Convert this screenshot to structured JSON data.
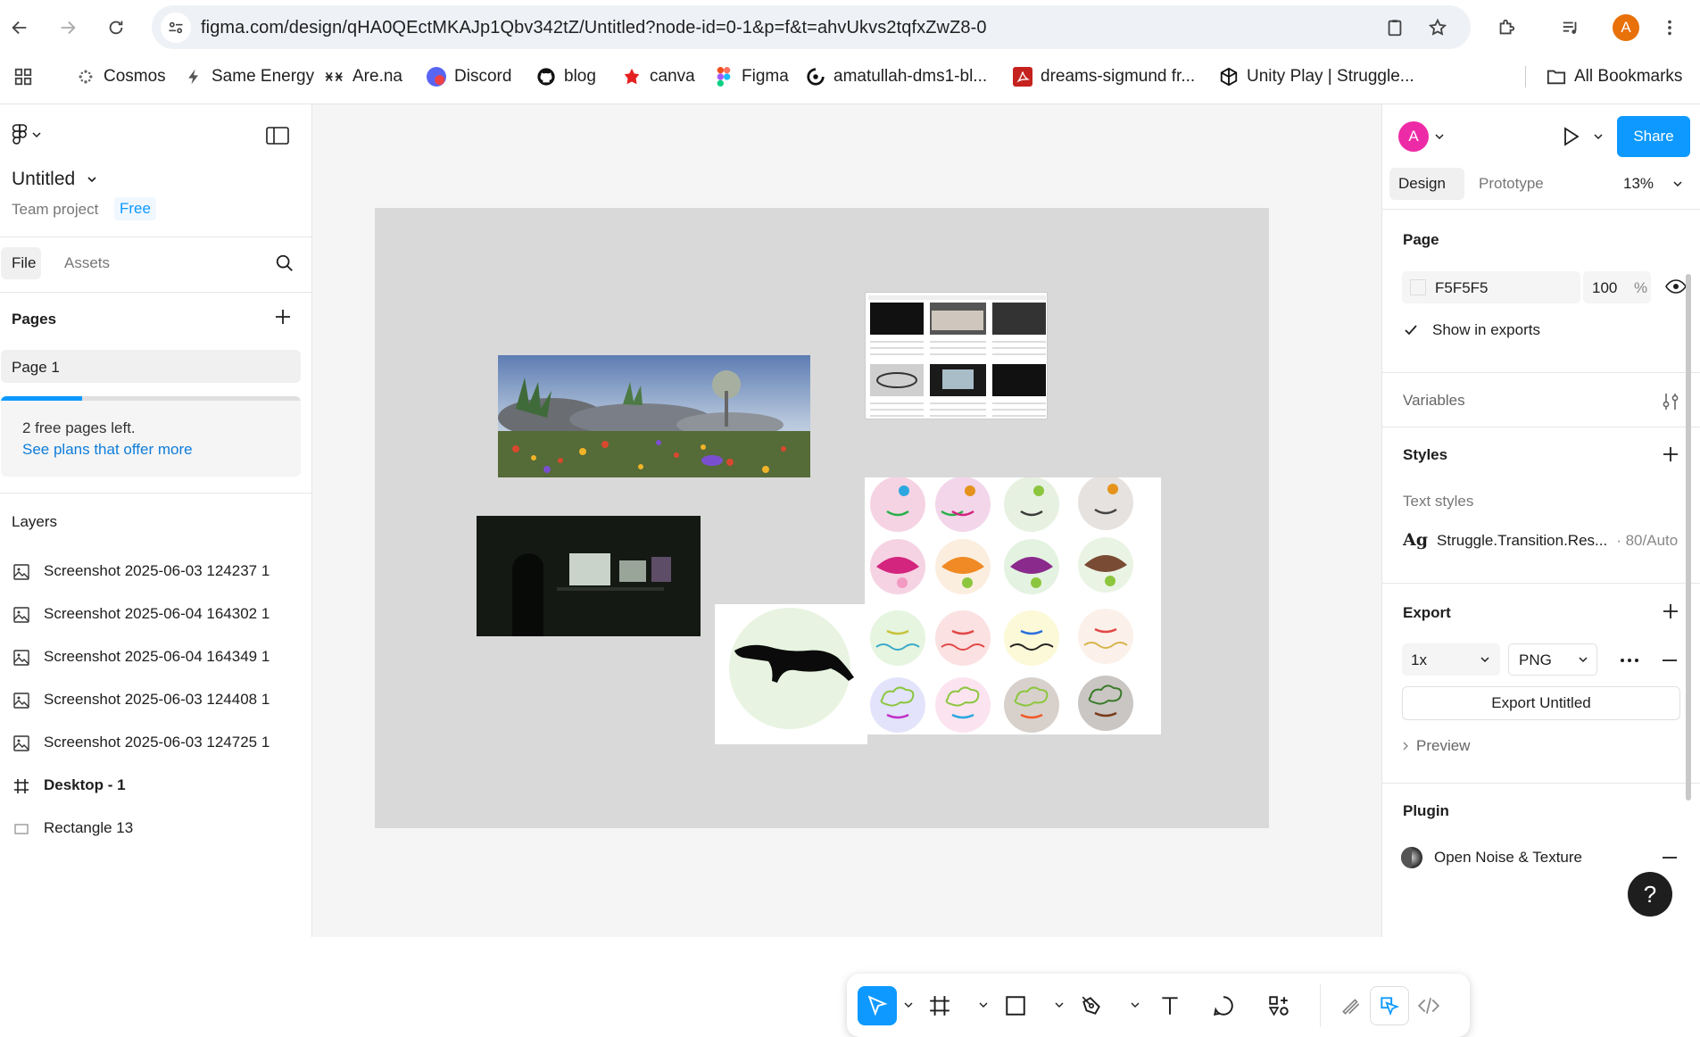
{
  "browser": {
    "url": "figma.com/design/qHA0QEctMKAJp1Qbv342tZ/Untitled?node-id=0-1&p=f&t=ahvUkvs2tqfxZwZ8-0",
    "profile_initial": "A",
    "bookmarks": [
      {
        "label": "Cosmos",
        "icon": "cosmos-icon"
      },
      {
        "label": "Same Energy",
        "icon": "lightning-icon"
      },
      {
        "label": "Are.na",
        "icon": "arena-icon"
      },
      {
        "label": "Discord",
        "icon": "discord-icon"
      },
      {
        "label": "blog",
        "icon": "github-icon"
      },
      {
        "label": "canva",
        "icon": "canva-icon"
      },
      {
        "label": "Figma",
        "icon": "figma-icon"
      },
      {
        "label": "amatullah-dms1-bl...",
        "icon": "github-icon"
      },
      {
        "label": "dreams-sigmund fr...",
        "icon": "pdf-icon"
      },
      {
        "label": "Unity Play | Struggle...",
        "icon": "unity-icon"
      }
    ],
    "all_bookmarks": "All Bookmarks"
  },
  "left_panel": {
    "file_name": "Untitled",
    "project": "Team project",
    "plan_badge": "Free",
    "tabs": {
      "file": "File",
      "assets": "Assets"
    },
    "pages_heading": "Pages",
    "pages": [
      {
        "label": "Page 1"
      }
    ],
    "upsell": {
      "line1": "2 free pages left.",
      "link": "See plans that offer more",
      "progress": 0.27
    },
    "layers_heading": "Layers",
    "layers": [
      {
        "label": "Screenshot 2025-06-03 124237 1",
        "type": "image"
      },
      {
        "label": "Screenshot 2025-06-04 164302 1",
        "type": "image"
      },
      {
        "label": "Screenshot 2025-06-04 164349 1",
        "type": "image"
      },
      {
        "label": "Screenshot 2025-06-03 124408 1",
        "type": "image"
      },
      {
        "label": "Screenshot 2025-06-03 124725 1",
        "type": "image"
      },
      {
        "label": "Desktop - 1",
        "type": "frame"
      },
      {
        "label": "Rectangle 13",
        "type": "rectangle"
      }
    ]
  },
  "right_panel": {
    "avatar_initial": "A",
    "share_label": "Share",
    "tabs": {
      "design": "Design",
      "prototype": "Prototype"
    },
    "zoom": "13%",
    "page_heading": "Page",
    "page_fill": {
      "hex": "F5F5F5",
      "opacity": "100",
      "unit": "%"
    },
    "show_in_exports": "Show in exports",
    "variables_heading": "Variables",
    "styles_heading": "Styles",
    "text_styles_label": "Text styles",
    "text_style": {
      "prefix": "Ag",
      "name": "Struggle.Transition.Res...",
      "meta": "· 80/Auto"
    },
    "export_heading": "Export",
    "export_scale": "1x",
    "export_format": "PNG",
    "export_button": "Export Untitled",
    "preview_label": "Preview",
    "plugin_heading": "Plugin",
    "plugin_name": "Open Noise & Texture",
    "help": "?"
  },
  "colors": {
    "accent": "#0d99ff",
    "avatar": "#ee2ba6",
    "profile": "#e8710a",
    "canvas": "#f5f5f5",
    "frame": "#d9d9d9"
  }
}
